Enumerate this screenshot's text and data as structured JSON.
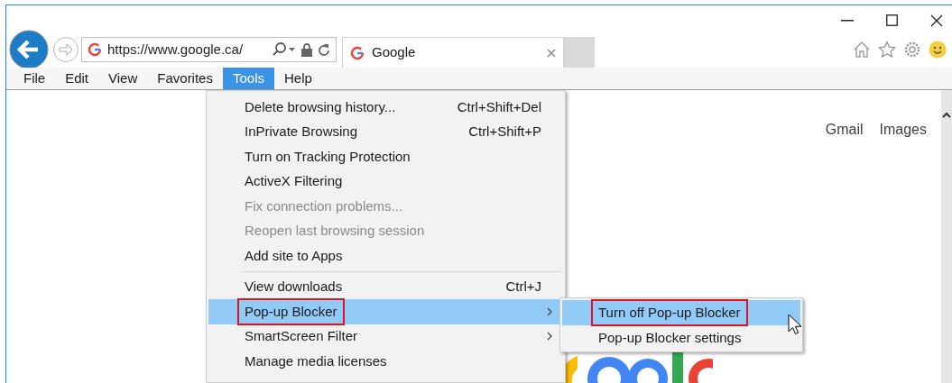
{
  "address_bar": {
    "url": "https://www.google.ca/"
  },
  "tab": {
    "title": "Google"
  },
  "menu_bar": [
    {
      "label": "File",
      "selected": false
    },
    {
      "label": "Edit",
      "selected": false
    },
    {
      "label": "View",
      "selected": false
    },
    {
      "label": "Favorites",
      "selected": false
    },
    {
      "label": "Tools",
      "selected": true
    },
    {
      "label": "Help",
      "selected": false
    }
  ],
  "page_links": [
    "Gmail",
    "Images"
  ],
  "tools_menu": [
    {
      "kind": "item",
      "label": "Delete browsing history...",
      "shortcut": "Ctrl+Shift+Del",
      "disabled": false,
      "selected": false,
      "submenu": false,
      "outlined": false
    },
    {
      "kind": "item",
      "label": "InPrivate Browsing",
      "shortcut": "Ctrl+Shift+P",
      "disabled": false,
      "selected": false,
      "submenu": false,
      "outlined": false
    },
    {
      "kind": "item",
      "label": "Turn on Tracking Protection",
      "disabled": false,
      "selected": false,
      "submenu": false,
      "outlined": false
    },
    {
      "kind": "item",
      "label": "ActiveX Filtering",
      "disabled": false,
      "selected": false,
      "submenu": false,
      "outlined": false
    },
    {
      "kind": "item",
      "label": "Fix connection problems...",
      "disabled": true,
      "selected": false,
      "submenu": false,
      "outlined": false
    },
    {
      "kind": "item",
      "label": "Reopen last browsing session",
      "disabled": true,
      "selected": false,
      "submenu": false,
      "outlined": false
    },
    {
      "kind": "item",
      "label": "Add site to Apps",
      "disabled": false,
      "selected": false,
      "submenu": false,
      "outlined": false
    },
    {
      "kind": "separator"
    },
    {
      "kind": "item",
      "label": "View downloads",
      "shortcut": "Ctrl+J",
      "disabled": false,
      "selected": false,
      "submenu": false,
      "outlined": false
    },
    {
      "kind": "item",
      "label": "Pop-up Blocker",
      "disabled": false,
      "selected": true,
      "submenu": true,
      "outlined": true
    },
    {
      "kind": "item",
      "label": "SmartScreen Filter",
      "disabled": false,
      "selected": false,
      "submenu": true,
      "outlined": false
    },
    {
      "kind": "item",
      "label": "Manage media licenses",
      "disabled": false,
      "selected": false,
      "submenu": false,
      "outlined": false
    }
  ],
  "submenu": [
    {
      "label": "Turn off Pop-up Blocker",
      "selected": true,
      "outlined": true
    },
    {
      "label": "Pop-up Blocker settings",
      "selected": false,
      "outlined": false
    }
  ]
}
